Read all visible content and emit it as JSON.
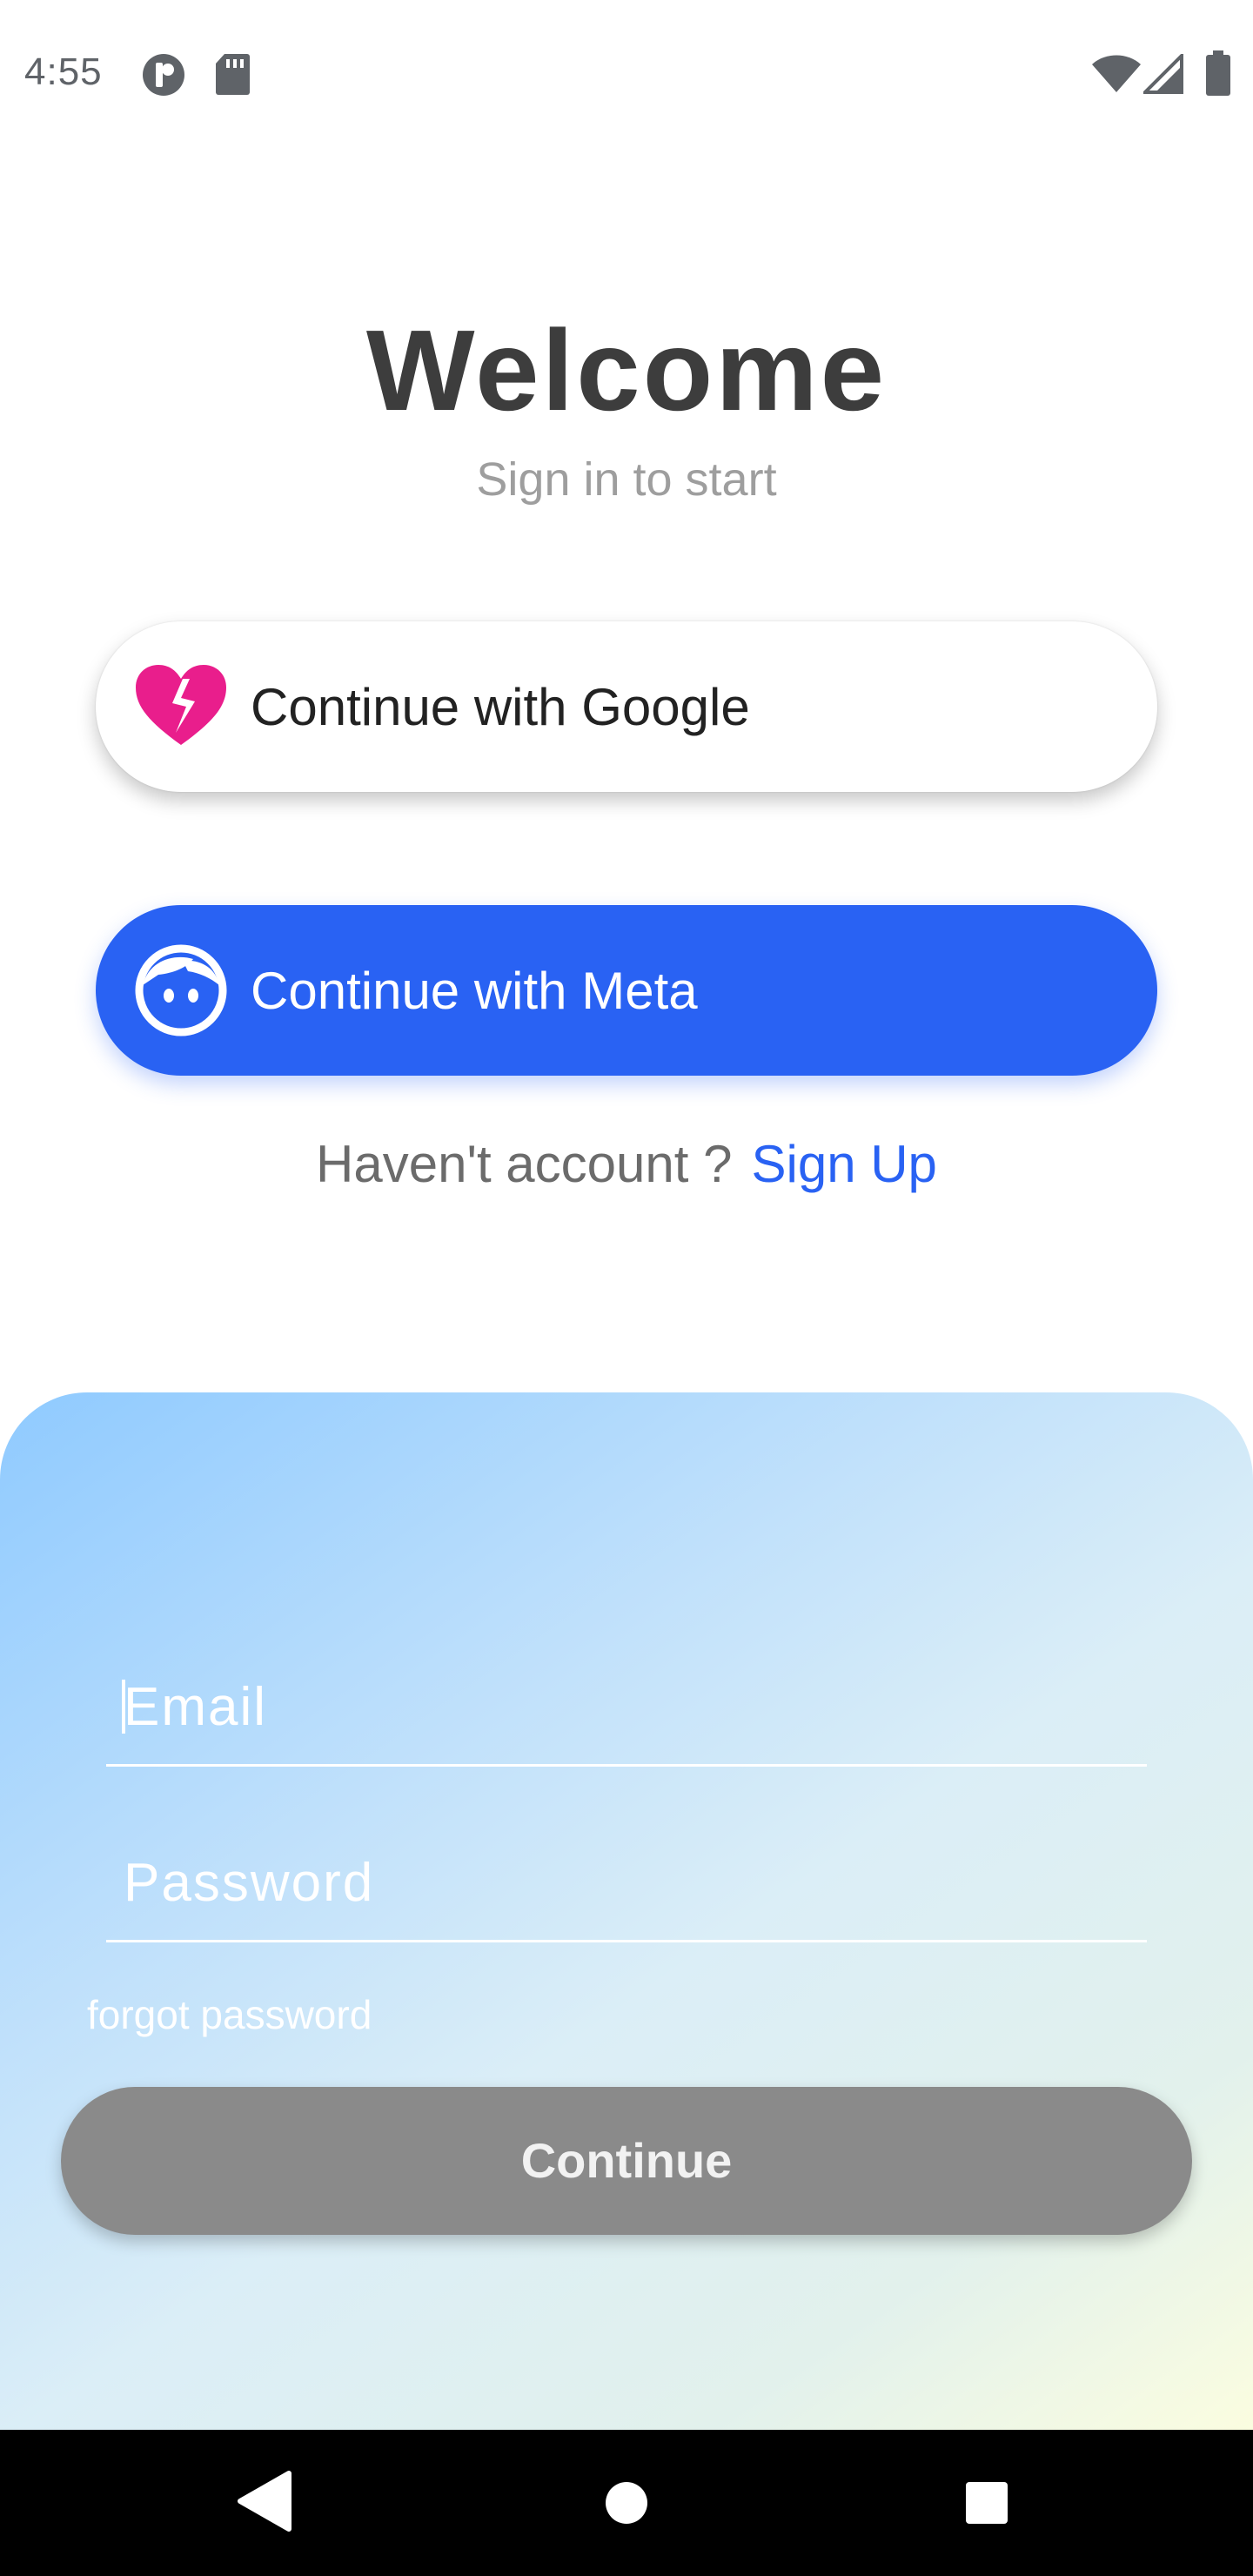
{
  "status_bar": {
    "time": "4:55",
    "icons": [
      "notification-app-icon",
      "sd-card-icon",
      "wifi-icon",
      "cell-signal-icon",
      "battery-icon"
    ]
  },
  "header": {
    "title": "Welcome",
    "subtitle": "Sign in to start"
  },
  "social": {
    "google_label": "Continue with Google",
    "google_icon": "broken-heart-icon",
    "meta_label": "Continue with Meta",
    "meta_icon": "face-icon"
  },
  "signup": {
    "prompt": "Haven't account ?",
    "link": "Sign Up"
  },
  "form": {
    "email_placeholder": "Email",
    "password_placeholder": "Password",
    "forgot_label": "forgot password",
    "continue_label": "Continue"
  },
  "nav_bar": {
    "icons": [
      "back-icon",
      "home-icon",
      "recents-icon"
    ]
  },
  "colors": {
    "accent": "#2962f3",
    "google_icon": "#e91e8c",
    "continue_disabled": "#8a8a8a",
    "title": "#3d3d3d"
  }
}
